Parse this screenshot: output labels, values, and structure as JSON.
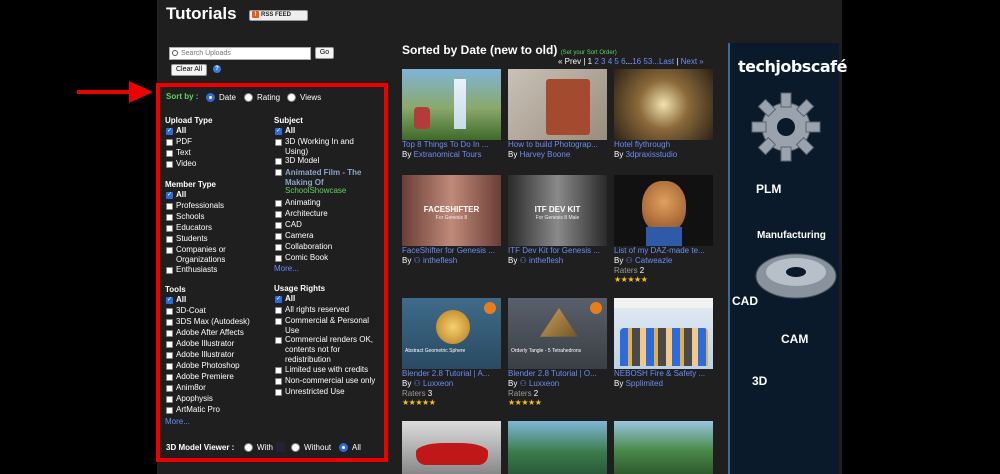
{
  "header": {
    "title": "Tutorials",
    "rss_label": "RSS FEED"
  },
  "search": {
    "placeholder": "Search Uploads",
    "go_label": "Go",
    "clear_label": "Clear All",
    "help_glyph": "?"
  },
  "sort": {
    "label": "Sort by :",
    "options": [
      "Date",
      "Rating",
      "Views"
    ],
    "selected": "Date"
  },
  "upload_type": {
    "heading": "Upload Type",
    "items": [
      "All",
      "PDF",
      "Text",
      "Video"
    ],
    "checked": [
      "All"
    ]
  },
  "member_type": {
    "heading": "Member Type",
    "items": [
      "All",
      "Professionals",
      "Schools",
      "Educators",
      "Students",
      "Companies or",
      "Organizations",
      "Enthusiasts"
    ],
    "checked": [
      "All"
    ]
  },
  "tools": {
    "heading": "Tools",
    "items": [
      "All",
      "3D-Coat",
      "3DS Max (Autodesk)",
      "Adobe After Affects",
      "Adobe Illustrator",
      "Adobe Illustrator",
      "Adobe Photoshop",
      "Adobe Premiere",
      "Anim8or",
      "Apophysis",
      "ArtMatic Pro"
    ],
    "checked": [
      "All"
    ],
    "more": "More..."
  },
  "subject": {
    "heading": "Subject",
    "items": [
      "All",
      "3D (Working In and",
      "Using)",
      "3D Model",
      "Animating",
      "Architecture",
      "CAD",
      "Camera",
      "Collaboration",
      "Comic Book"
    ],
    "checked": [
      "All"
    ],
    "featured": "Animated Film - The Making Of",
    "featured_sub": "SchoolShowcase",
    "more": "More..."
  },
  "usage_rights": {
    "heading": "Usage Rights",
    "items": [
      "All",
      "All rights reserved",
      "Commercial & Personal",
      "Use",
      "Commercial renders OK,",
      "contents not for",
      "redistribution",
      "Limited use with credits",
      "Non-commercial use only",
      "Unrestricted Use"
    ],
    "checked": [
      "All"
    ]
  },
  "viewer": {
    "label": "3D Model Viewer :",
    "options": [
      "With",
      "Without",
      "All"
    ],
    "selected": "All"
  },
  "results": {
    "heading": "Sorted by Date (new to old)",
    "set_order": "(Set your Sort Order)",
    "pager": {
      "prev": "« Prev",
      "sep": "|",
      "current": "1",
      "pages": [
        "2",
        "3",
        "4",
        "5",
        "6"
      ],
      "ellipsis": "...",
      "p16": "16",
      "p53": "53",
      "last": "...Last",
      "next": "Next »"
    },
    "tiles": [
      {
        "title": "Top 8 Things To Do In ...",
        "by": "By",
        "author": "Extranomical Tours",
        "raters": "",
        "stars": ""
      },
      {
        "title": "How to build Photograp...",
        "by": "By",
        "author": "Harvey Boone",
        "raters": "",
        "stars": ""
      },
      {
        "title": "Hotel flythrough",
        "by": "By",
        "author": "3dpraxisstudio",
        "raters": "",
        "stars": ""
      },
      {
        "title": "FaceShifter for Genesis ...",
        "by": "By",
        "author": "intheflesh",
        "raters": "",
        "stars": ""
      },
      {
        "title": "ITF Dev Kit for Genesis ...",
        "by": "By",
        "author": "intheflesh",
        "raters": "",
        "stars": ""
      },
      {
        "title": "List of my DAZ-made te...",
        "by": "By",
        "author": "Catweazle",
        "raters": "2",
        "stars": "★★★★★"
      },
      {
        "title": "Blender 2.8 Tutorial | A...",
        "by": "By",
        "author": "Luxxeon",
        "raters": "3",
        "stars": "★★★★★"
      },
      {
        "title": "Blender 2.8 Tutorial | O...",
        "by": "By",
        "author": "Luxxeon",
        "raters": "2",
        "stars": "★★★★★"
      },
      {
        "title": "NEBOSH Fire & Safety ...",
        "by": "By",
        "author": "Spplimited",
        "raters": "",
        "stars": ""
      }
    ],
    "raters_label": "Raters",
    "thumb_text": {
      "faceshifter": "FACESHIFTER",
      "faceshifter_sub": "For Genesis 8",
      "itf": "ITF DEV KIT",
      "itf_sub": "For Genesis 8 Male",
      "blender_a": "Abstract Geometric Sphere",
      "blender_o": "Orderly Tangle - 5 Tetrahedrons"
    }
  },
  "ad": {
    "logo": "techjobscafé",
    "words": [
      "PLM",
      "Manufacturing",
      "CAD",
      "CAM",
      "3D"
    ]
  },
  "colors": {
    "accent_red": "#e00000",
    "link_blue": "#6b8df2",
    "green": "#5fd35f",
    "star_gold": "#f4c21c"
  }
}
